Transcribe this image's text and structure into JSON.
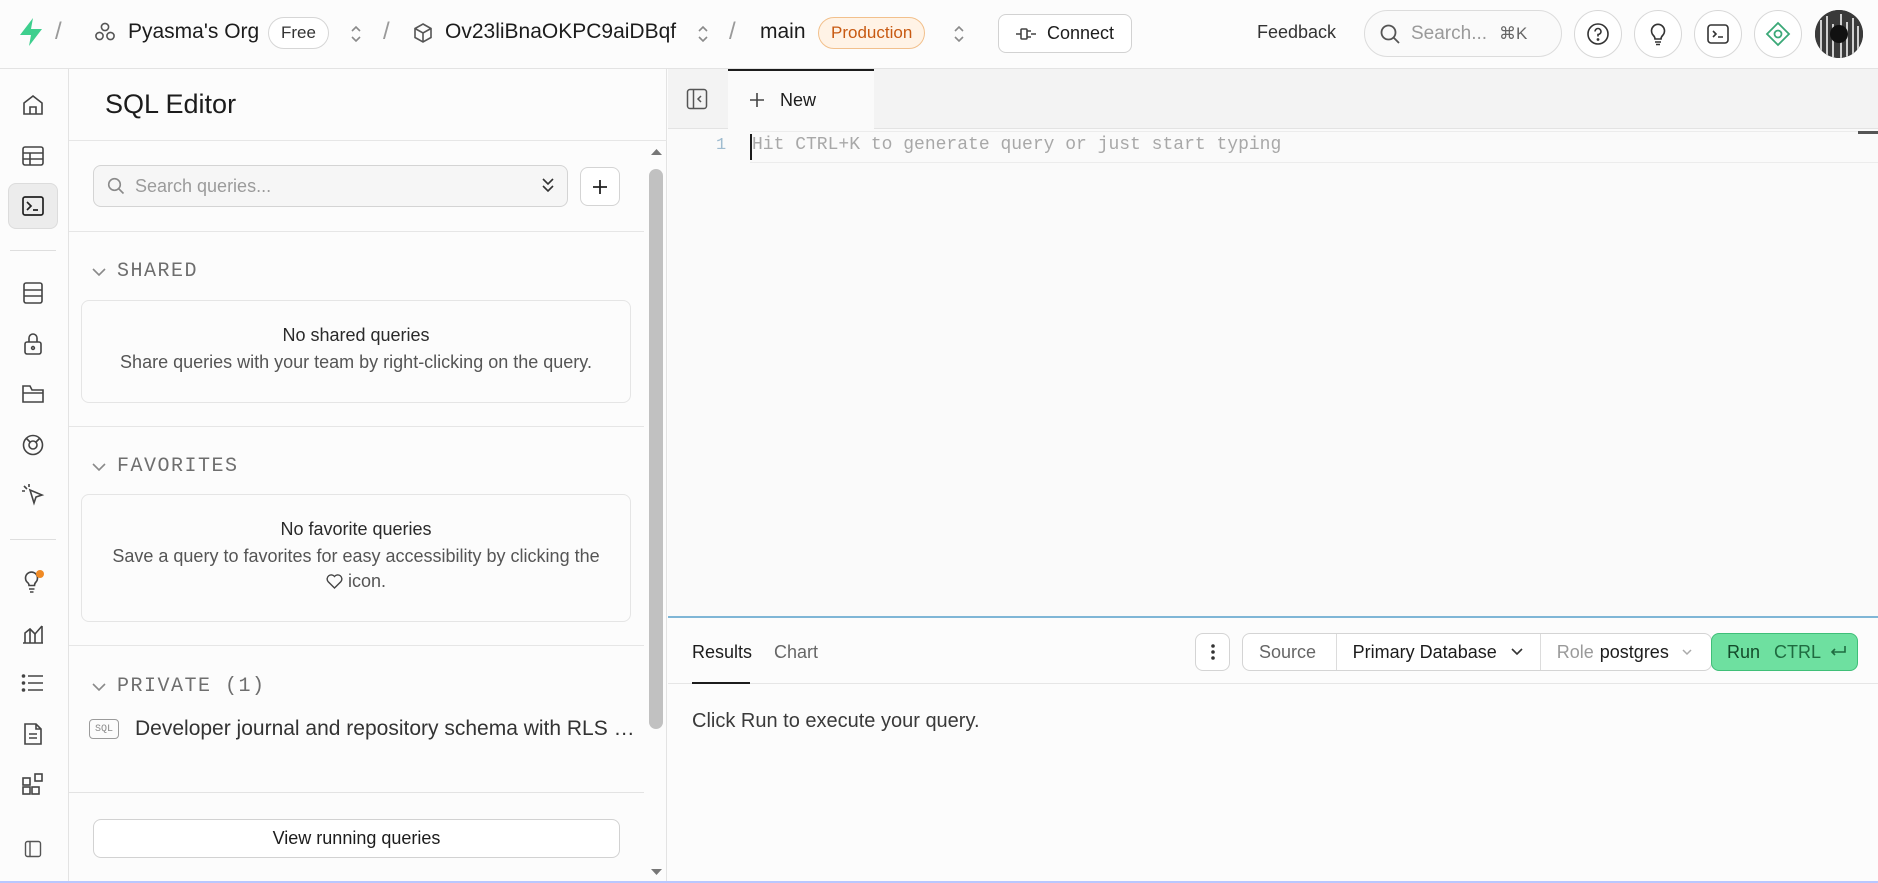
{
  "topbar": {
    "org_name": "Pyasma's Org",
    "plan_badge": "Free",
    "project_id": "Ov23liBnaOKPC9aiDBqf",
    "branch": "main",
    "env_badge": "Production",
    "connect_label": "Connect",
    "feedback_label": "Feedback",
    "search_placeholder": "Search...",
    "search_shortcut": "⌘K"
  },
  "sidebar": {
    "title": "SQL Editor",
    "search_placeholder": "Search queries...",
    "shared": {
      "label": "SHARED",
      "empty_title": "No shared queries",
      "empty_desc": "Share queries with your team by right-clicking on the query."
    },
    "favorites": {
      "label": "FAVORITES",
      "empty_title": "No favorite queries",
      "empty_desc_1": "Save a query to favorites for easy accessibility by clicking the",
      "empty_desc_2": "icon."
    },
    "private": {
      "label": "PRIVATE (1)",
      "items": [
        {
          "badge": "SQL",
          "name": "Developer journal and repository schema with RLS …"
        }
      ]
    },
    "view_running_label": "View running queries"
  },
  "editor": {
    "tab_label": "New",
    "line_number": "1",
    "placeholder": "Hit CTRL+K to generate query or just start typing"
  },
  "results": {
    "tabs": [
      "Results",
      "Chart"
    ],
    "source_label": "Source",
    "database": "Primary Database",
    "role_label": "Role",
    "role_value": "postgres",
    "run_label": "Run",
    "run_shortcut": "CTRL",
    "empty_message": "Click Run to execute your query."
  },
  "colors": {
    "brand_green": "#3ecf8e",
    "production_orange": "#c85a12",
    "run_green": "#6ee0a0",
    "notification_dot": "#f08a24"
  }
}
